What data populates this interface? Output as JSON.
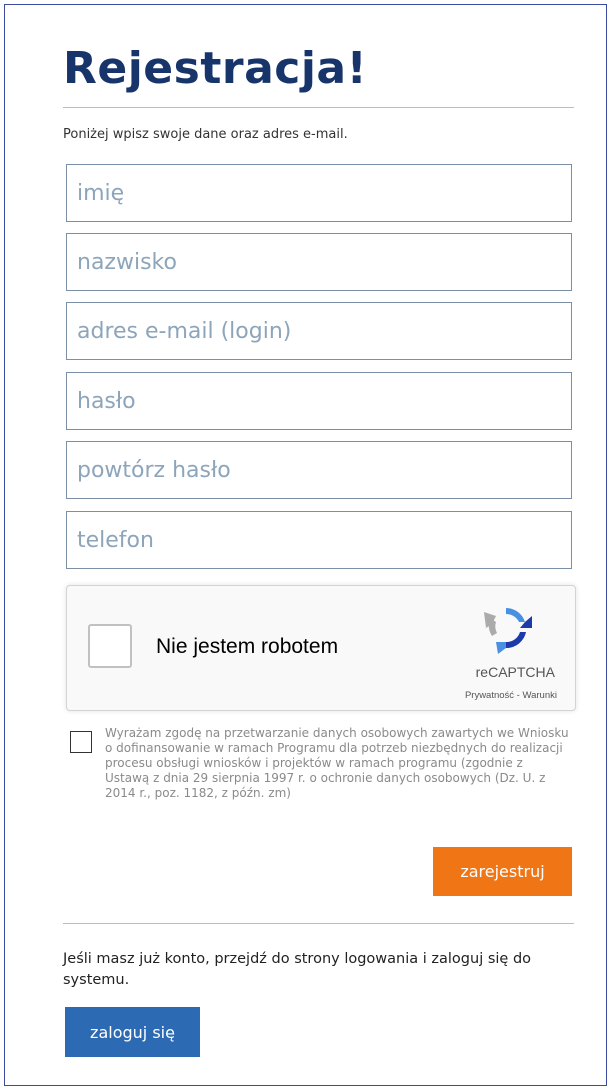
{
  "page": {
    "title": "Rejestracja!",
    "intro": "Poniżej wpisz swoje dane oraz adres e-mail."
  },
  "form": {
    "fields": [
      {
        "name": "first-name",
        "placeholder": "imię",
        "value": ""
      },
      {
        "name": "last-name",
        "placeholder": "nazwisko",
        "value": ""
      },
      {
        "name": "email",
        "placeholder": "adres e-mail (login)",
        "value": ""
      },
      {
        "name": "password",
        "placeholder": "hasło",
        "value": ""
      },
      {
        "name": "password-repeat",
        "placeholder": "powtórz hasło",
        "value": ""
      },
      {
        "name": "phone",
        "placeholder": "telefon",
        "value": ""
      }
    ],
    "recaptcha": {
      "label": "Nie jestem robotem",
      "brand": "reCAPTCHA",
      "privacy": "Prywatność",
      "separator": " - ",
      "terms": "Warunki",
      "checked": false,
      "icon": "recaptcha-logo-icon"
    },
    "consent": {
      "checked": false,
      "text": "Wyrażam zgodę na przetwarzanie danych osobowych zawartych we Wniosku o dofinansowanie w ramach Programu dla potrzeb niezbędnych do realizacji procesu obsługi wniosków i projektów w ramach programu (zgodnie z Ustawą z dnia 29 sierpnia 1997 r. o ochronie danych osobowych (Dz. U. z 2014 r., poz. 1182, z późn. zm)"
    },
    "register_label": "zarejestruj"
  },
  "login": {
    "info": "Jeśli masz już konto, przejdź do strony logowania i zaloguj się do systemu.",
    "button_label": "zaloguj się"
  },
  "colors": {
    "title": "#17346b",
    "panel_border": "#3b4ba0",
    "field_border": "#7b8fa6",
    "placeholder": "#8da5bb",
    "register_button": "#f07615",
    "login_button": "#2c6ab3",
    "consent_text": "#8a8a8a"
  }
}
